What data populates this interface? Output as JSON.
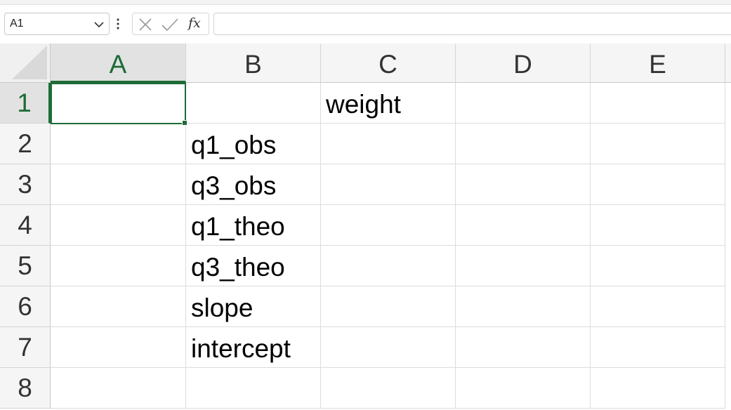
{
  "formula_bar": {
    "name_box": "A1",
    "function_label": "fx",
    "formula_value": ""
  },
  "columns": [
    "A",
    "B",
    "C",
    "D",
    "E"
  ],
  "rows": [
    "1",
    "2",
    "3",
    "4",
    "5",
    "6",
    "7",
    "8"
  ],
  "cells": {
    "B2": "q1_obs",
    "B3": "q3_obs",
    "B4": "q1_theo",
    "B5": "q3_theo",
    "B6": "slope",
    "B7": "intercept",
    "C1": "weight"
  },
  "selected_cell": "A1",
  "colors": {
    "accent": "#1e6b37"
  }
}
